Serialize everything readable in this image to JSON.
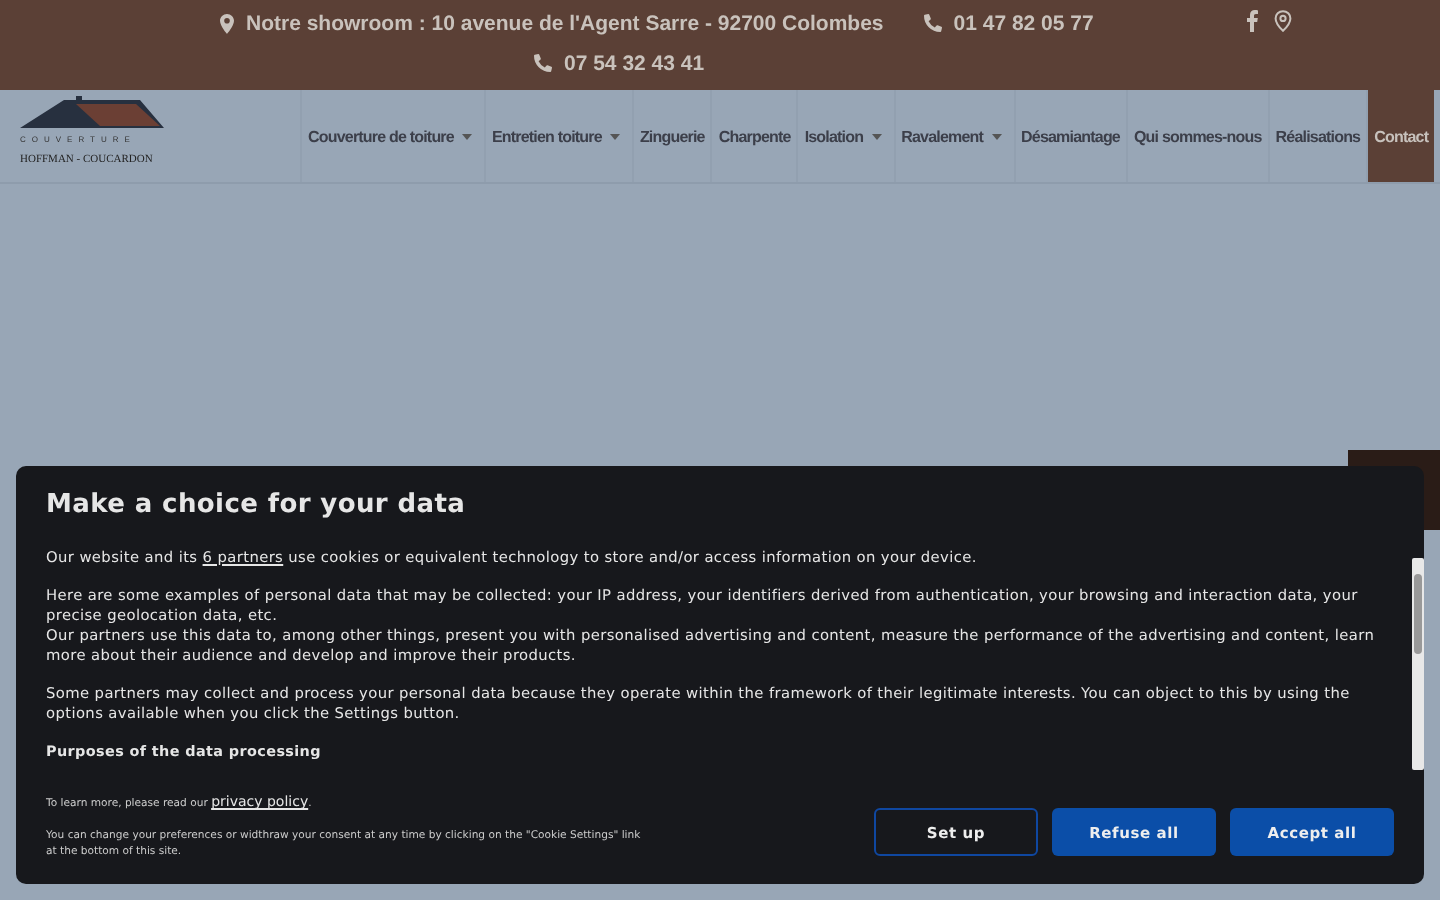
{
  "top_bar": {
    "address": "Notre showroom : 10 avenue de l'Agent Sarre - 92700 Colombes",
    "phones": [
      "01 47 82 05 77",
      "07 54 32 43 41"
    ]
  },
  "logo": {
    "tagline": "COUVERTURE",
    "name": "HOFFMAN - COUCARDON"
  },
  "nav": [
    {
      "label": "Couverture de toiture",
      "has_menu": true,
      "selected": false
    },
    {
      "label": "Entretien toiture",
      "has_menu": true,
      "selected": false
    },
    {
      "label": "Zinguerie",
      "has_menu": false,
      "selected": false
    },
    {
      "label": "Charpente",
      "has_menu": false,
      "selected": false
    },
    {
      "label": "Isolation",
      "has_menu": true,
      "selected": false
    },
    {
      "label": "Ravalement",
      "has_menu": true,
      "selected": false
    },
    {
      "label": "Désamiantage",
      "has_menu": false,
      "selected": false
    },
    {
      "label": "Qui sommes-nous",
      "has_menu": false,
      "selected": false
    },
    {
      "label": "Réalisations",
      "has_menu": false,
      "selected": false
    },
    {
      "label": "Contact",
      "has_menu": false,
      "selected": true
    }
  ],
  "consent": {
    "title": "Make a choice for your data",
    "paragraphs": [
      {
        "before": "Our website and its ",
        "link": "6 partners",
        "after": " use cookies or equivalent technology to store and/or access information on your device."
      },
      {
        "lines": [
          "Here are some examples of personal data that may be collected: your IP address, your identifiers derived from authentication, your browsing and interaction data, your precise geolocation data, etc.",
          "Our partners use this data to, among other things, present you with personalised advertising and content, measure the performance of the advertising and content, learn more about their audience and develop and improve their products."
        ]
      },
      {
        "lines": [
          "Some partners may collect and process your personal data because they operate within the framework of their legitimate interests. You can object to this by using the options available when you click the Settings button."
        ]
      }
    ],
    "section_heading": "Purposes of the data processing",
    "privacy_before": "To learn more, please read our ",
    "privacy_link": "privacy policy",
    "privacy_after": ".",
    "preferences_note": "You can change your preferences or widthraw your consent at any time by clicking on the \"Cookie Settings\" link at the bottom of this site.",
    "buttons": [
      {
        "label": "Set up",
        "kind": "outline"
      },
      {
        "label": "Refuse all",
        "kind": "filled"
      },
      {
        "label": "Accept all",
        "kind": "filled"
      }
    ]
  }
}
